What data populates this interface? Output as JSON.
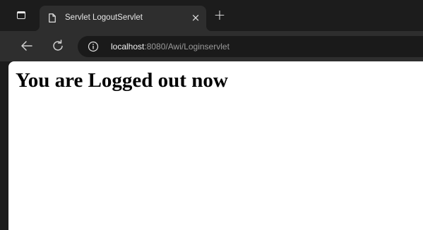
{
  "tab": {
    "title": "Servlet LogoutServlet",
    "close_icon": "close-icon",
    "page_icon": "page-icon"
  },
  "new_tab_icon": "plus-icon",
  "toolbar": {
    "back_icon": "arrow-left-icon",
    "reload_icon": "reload-icon",
    "site_info_icon": "info-icon"
  },
  "address": {
    "host": "localhost",
    "rest": ":8080/Awi/Loginservlet"
  },
  "page": {
    "heading": "You are Logged out now"
  },
  "colors": {
    "frame": "#1c1c1c",
    "toolbar": "#2e2e2e",
    "omnibox": "#1a1a1a",
    "page_background": "#ffffff"
  }
}
